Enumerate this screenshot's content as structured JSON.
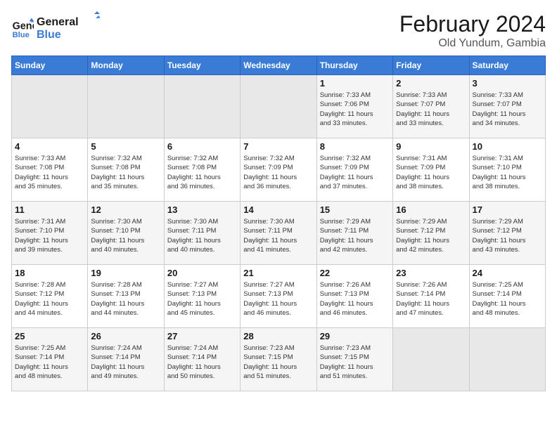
{
  "header": {
    "logo_line1": "General",
    "logo_line2": "Blue",
    "main_title": "February 2024",
    "subtitle": "Old Yundum, Gambia"
  },
  "days_of_week": [
    "Sunday",
    "Monday",
    "Tuesday",
    "Wednesday",
    "Thursday",
    "Friday",
    "Saturday"
  ],
  "weeks": [
    [
      {
        "num": "",
        "info": "",
        "empty": true
      },
      {
        "num": "",
        "info": "",
        "empty": true
      },
      {
        "num": "",
        "info": "",
        "empty": true
      },
      {
        "num": "",
        "info": "",
        "empty": true
      },
      {
        "num": "1",
        "info": "Sunrise: 7:33 AM\nSunset: 7:06 PM\nDaylight: 11 hours\nand 33 minutes."
      },
      {
        "num": "2",
        "info": "Sunrise: 7:33 AM\nSunset: 7:07 PM\nDaylight: 11 hours\nand 33 minutes."
      },
      {
        "num": "3",
        "info": "Sunrise: 7:33 AM\nSunset: 7:07 PM\nDaylight: 11 hours\nand 34 minutes."
      }
    ],
    [
      {
        "num": "4",
        "info": "Sunrise: 7:33 AM\nSunset: 7:08 PM\nDaylight: 11 hours\nand 35 minutes."
      },
      {
        "num": "5",
        "info": "Sunrise: 7:32 AM\nSunset: 7:08 PM\nDaylight: 11 hours\nand 35 minutes."
      },
      {
        "num": "6",
        "info": "Sunrise: 7:32 AM\nSunset: 7:08 PM\nDaylight: 11 hours\nand 36 minutes."
      },
      {
        "num": "7",
        "info": "Sunrise: 7:32 AM\nSunset: 7:09 PM\nDaylight: 11 hours\nand 36 minutes."
      },
      {
        "num": "8",
        "info": "Sunrise: 7:32 AM\nSunset: 7:09 PM\nDaylight: 11 hours\nand 37 minutes."
      },
      {
        "num": "9",
        "info": "Sunrise: 7:31 AM\nSunset: 7:09 PM\nDaylight: 11 hours\nand 38 minutes."
      },
      {
        "num": "10",
        "info": "Sunrise: 7:31 AM\nSunset: 7:10 PM\nDaylight: 11 hours\nand 38 minutes."
      }
    ],
    [
      {
        "num": "11",
        "info": "Sunrise: 7:31 AM\nSunset: 7:10 PM\nDaylight: 11 hours\nand 39 minutes."
      },
      {
        "num": "12",
        "info": "Sunrise: 7:30 AM\nSunset: 7:10 PM\nDaylight: 11 hours\nand 40 minutes."
      },
      {
        "num": "13",
        "info": "Sunrise: 7:30 AM\nSunset: 7:11 PM\nDaylight: 11 hours\nand 40 minutes."
      },
      {
        "num": "14",
        "info": "Sunrise: 7:30 AM\nSunset: 7:11 PM\nDaylight: 11 hours\nand 41 minutes."
      },
      {
        "num": "15",
        "info": "Sunrise: 7:29 AM\nSunset: 7:11 PM\nDaylight: 11 hours\nand 42 minutes."
      },
      {
        "num": "16",
        "info": "Sunrise: 7:29 AM\nSunset: 7:12 PM\nDaylight: 11 hours\nand 42 minutes."
      },
      {
        "num": "17",
        "info": "Sunrise: 7:29 AM\nSunset: 7:12 PM\nDaylight: 11 hours\nand 43 minutes."
      }
    ],
    [
      {
        "num": "18",
        "info": "Sunrise: 7:28 AM\nSunset: 7:12 PM\nDaylight: 11 hours\nand 44 minutes."
      },
      {
        "num": "19",
        "info": "Sunrise: 7:28 AM\nSunset: 7:13 PM\nDaylight: 11 hours\nand 44 minutes."
      },
      {
        "num": "20",
        "info": "Sunrise: 7:27 AM\nSunset: 7:13 PM\nDaylight: 11 hours\nand 45 minutes."
      },
      {
        "num": "21",
        "info": "Sunrise: 7:27 AM\nSunset: 7:13 PM\nDaylight: 11 hours\nand 46 minutes."
      },
      {
        "num": "22",
        "info": "Sunrise: 7:26 AM\nSunset: 7:13 PM\nDaylight: 11 hours\nand 46 minutes."
      },
      {
        "num": "23",
        "info": "Sunrise: 7:26 AM\nSunset: 7:14 PM\nDaylight: 11 hours\nand 47 minutes."
      },
      {
        "num": "24",
        "info": "Sunrise: 7:25 AM\nSunset: 7:14 PM\nDaylight: 11 hours\nand 48 minutes."
      }
    ],
    [
      {
        "num": "25",
        "info": "Sunrise: 7:25 AM\nSunset: 7:14 PM\nDaylight: 11 hours\nand 48 minutes."
      },
      {
        "num": "26",
        "info": "Sunrise: 7:24 AM\nSunset: 7:14 PM\nDaylight: 11 hours\nand 49 minutes."
      },
      {
        "num": "27",
        "info": "Sunrise: 7:24 AM\nSunset: 7:14 PM\nDaylight: 11 hours\nand 50 minutes."
      },
      {
        "num": "28",
        "info": "Sunrise: 7:23 AM\nSunset: 7:15 PM\nDaylight: 11 hours\nand 51 minutes."
      },
      {
        "num": "29",
        "info": "Sunrise: 7:23 AM\nSunset: 7:15 PM\nDaylight: 11 hours\nand 51 minutes."
      },
      {
        "num": "",
        "info": "",
        "empty": true
      },
      {
        "num": "",
        "info": "",
        "empty": true
      }
    ]
  ]
}
